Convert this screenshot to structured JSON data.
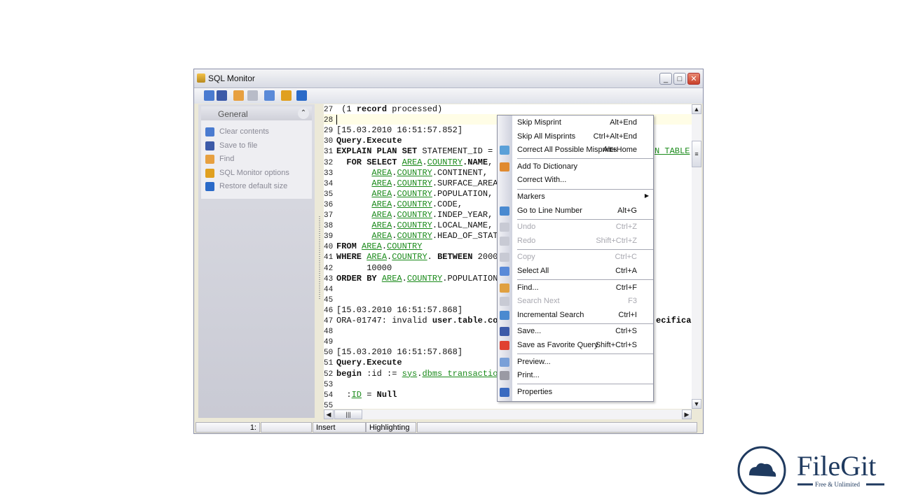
{
  "window": {
    "title": "SQL Monitor",
    "minimize": "_",
    "maximize": "□",
    "close": "✕"
  },
  "toolbar": [
    "clear-contents-icon",
    "save-icon",
    "find-icon",
    "search-next-icon",
    "print-icon",
    "options-icon",
    "restore-size-icon"
  ],
  "sidebar": {
    "group_title": "General",
    "collapse_glyph": "⌃",
    "items": [
      {
        "label": "Clear contents",
        "icon": "clear-contents-icon",
        "color": "#4a7bd0"
      },
      {
        "label": "Save to file",
        "icon": "save-icon",
        "color": "#3c5aa8"
      },
      {
        "label": "Find",
        "icon": "find-icon",
        "color": "#e7a040"
      },
      {
        "label": "SQL Monitor options",
        "icon": "options-icon",
        "color": "#e0a020"
      },
      {
        "label": "Restore default size",
        "icon": "restore-size-icon",
        "color": "#2a6ac8"
      }
    ]
  },
  "editor": {
    "lines": [
      {
        "n": "27",
        "s": [
          [
            "n",
            " (1 "
          ],
          [
            "k",
            "record"
          ],
          [
            "n",
            " processed)"
          ]
        ]
      },
      {
        "n": "28",
        "s": []
      },
      {
        "n": "29",
        "s": [
          [
            "n",
            "[15.03.2010 16:51:57.852]"
          ]
        ]
      },
      {
        "n": "30",
        "s": [
          [
            "k",
            "Query.Execute"
          ]
        ]
      },
      {
        "n": "31",
        "s": [
          [
            "k",
            "EXPLAIN PLAN SET"
          ],
          [
            "n",
            " STATEMENT_ID ="
          ]
        ]
      },
      {
        "n": "32",
        "s": [
          [
            "k",
            "  FOR SELECT "
          ],
          [
            "id",
            "AREA"
          ],
          [
            "n",
            "."
          ],
          [
            "id",
            "COUNTRY"
          ],
          [
            "k",
            ".NAME"
          ],
          [
            "n",
            ","
          ]
        ]
      },
      {
        "n": "33",
        "s": [
          [
            "n",
            "       "
          ],
          [
            "id",
            "AREA"
          ],
          [
            "n",
            "."
          ],
          [
            "id",
            "COUNTRY"
          ],
          [
            "n",
            ".CONTINENT,"
          ]
        ]
      },
      {
        "n": "34",
        "s": [
          [
            "n",
            "       "
          ],
          [
            "id",
            "AREA"
          ],
          [
            "n",
            "."
          ],
          [
            "id",
            "COUNTRY"
          ],
          [
            "n",
            ".SURFACE_AREA"
          ]
        ]
      },
      {
        "n": "35",
        "s": [
          [
            "n",
            "       "
          ],
          [
            "id",
            "AREA"
          ],
          [
            "n",
            "."
          ],
          [
            "id",
            "COUNTRY"
          ],
          [
            "n",
            ".POPULATION,"
          ]
        ]
      },
      {
        "n": "36",
        "s": [
          [
            "n",
            "       "
          ],
          [
            "id",
            "AREA"
          ],
          [
            "n",
            "."
          ],
          [
            "id",
            "COUNTRY"
          ],
          [
            "n",
            ".CODE,"
          ]
        ]
      },
      {
        "n": "37",
        "s": [
          [
            "n",
            "       "
          ],
          [
            "id",
            "AREA"
          ],
          [
            "n",
            "."
          ],
          [
            "id",
            "COUNTRY"
          ],
          [
            "n",
            ".INDEP_YEAR,"
          ]
        ]
      },
      {
        "n": "38",
        "s": [
          [
            "n",
            "       "
          ],
          [
            "id",
            "AREA"
          ],
          [
            "n",
            "."
          ],
          [
            "id",
            "COUNTRY"
          ],
          [
            "n",
            ".LOCAL_NAME,"
          ]
        ]
      },
      {
        "n": "39",
        "s": [
          [
            "n",
            "       "
          ],
          [
            "id",
            "AREA"
          ],
          [
            "n",
            "."
          ],
          [
            "id",
            "COUNTRY"
          ],
          [
            "n",
            ".HEAD_OF_STAT"
          ]
        ]
      },
      {
        "n": "40",
        "s": [
          [
            "k",
            "FROM "
          ],
          [
            "id",
            "AREA"
          ],
          [
            "n",
            "."
          ],
          [
            "id",
            "COUNTRY"
          ]
        ]
      },
      {
        "n": "41",
        "s": [
          [
            "k",
            "WHERE "
          ],
          [
            "id",
            "AREA"
          ],
          [
            "n",
            "."
          ],
          [
            "id",
            "COUNTRY"
          ],
          [
            "n",
            ". "
          ],
          [
            "k",
            "BETWEEN"
          ],
          [
            "n",
            " 2000"
          ]
        ]
      },
      {
        "n": "42",
        "s": [
          [
            "n",
            "      10000"
          ]
        ]
      },
      {
        "n": "43",
        "s": [
          [
            "k",
            "ORDER BY "
          ],
          [
            "id",
            "AREA"
          ],
          [
            "n",
            "."
          ],
          [
            "id",
            "COUNTRY"
          ],
          [
            "n",
            ".POPULATION"
          ]
        ]
      },
      {
        "n": "44",
        "s": []
      },
      {
        "n": "45",
        "s": []
      },
      {
        "n": "46",
        "s": [
          [
            "n",
            "[15.03.2010 16:51:57.868]"
          ]
        ]
      },
      {
        "n": "47",
        "s": [
          [
            "n",
            "ORA-01747: invalid "
          ],
          [
            "k",
            "user.table.co"
          ]
        ]
      },
      {
        "n": "48",
        "s": []
      },
      {
        "n": "49",
        "s": []
      },
      {
        "n": "50",
        "s": [
          [
            "n",
            "[15.03.2010 16:51:57.868]"
          ]
        ]
      },
      {
        "n": "51",
        "s": [
          [
            "k",
            "Query.Execute"
          ]
        ]
      },
      {
        "n": "52",
        "s": [
          [
            "k",
            "begin"
          ],
          [
            "n",
            " :id := "
          ],
          [
            "id",
            "sys"
          ],
          [
            "n",
            "."
          ],
          [
            "id",
            "dbms transactio"
          ]
        ]
      },
      {
        "n": "53",
        "s": []
      },
      {
        "n": "54",
        "s": [
          [
            "n",
            "  :"
          ],
          [
            "id",
            "ID"
          ],
          [
            "n",
            " = "
          ],
          [
            "k",
            "Null"
          ]
        ]
      },
      {
        "n": "55",
        "s": []
      }
    ],
    "tail_31": "N TABLE",
    "tail_47": "ecifica"
  },
  "status": {
    "position": "1:",
    "mode": "Insert",
    "highlighting": "Highlighting"
  },
  "context_menu": [
    {
      "label": "Skip Misprint",
      "shortcut": "Alt+End"
    },
    {
      "label": "Skip All Misprints",
      "shortcut": "Ctrl+Alt+End"
    },
    {
      "label": "Correct All Possible Misprints",
      "shortcut": "Alt+Home",
      "icon": "spellcheck-icon",
      "color": "#5aa0d8"
    },
    {
      "sep": true
    },
    {
      "label": "Add To Dictionary",
      "icon": "dictionary-icon",
      "color": "#e08a30"
    },
    {
      "label": "Correct With..."
    },
    {
      "sep": true
    },
    {
      "label": "Markers",
      "submenu": true
    },
    {
      "label": "Go to Line Number",
      "shortcut": "Alt+G",
      "icon": "goto-line-icon",
      "color": "#4a8ad0"
    },
    {
      "sep": true
    },
    {
      "label": "Undo",
      "shortcut": "Ctrl+Z",
      "disabled": true,
      "icon": "undo-icon",
      "color": "#c8cad4"
    },
    {
      "label": "Redo",
      "shortcut": "Shift+Ctrl+Z",
      "disabled": true,
      "icon": "redo-icon",
      "color": "#c8cad4"
    },
    {
      "sep": true
    },
    {
      "label": "Copy",
      "shortcut": "Ctrl+C",
      "disabled": true,
      "icon": "copy-icon",
      "color": "#c8cad4"
    },
    {
      "label": "Select All",
      "shortcut": "Ctrl+A",
      "icon": "select-all-icon",
      "color": "#5a8ad8"
    },
    {
      "sep": true
    },
    {
      "label": "Find...",
      "shortcut": "Ctrl+F",
      "icon": "find-icon",
      "color": "#e0a040"
    },
    {
      "label": "Search Next",
      "shortcut": "F3",
      "disabled": true,
      "icon": "search-next-icon",
      "color": "#c8cad4"
    },
    {
      "label": "Incremental Search",
      "shortcut": "Ctrl+I",
      "icon": "incremental-search-icon",
      "color": "#4a8ad0"
    },
    {
      "sep": true
    },
    {
      "label": "Save...",
      "shortcut": "Ctrl+S",
      "icon": "save-icon",
      "color": "#3c5aa8"
    },
    {
      "label": "Save as Favorite Query",
      "shortcut": "Shift+Ctrl+S",
      "icon": "favorite-icon",
      "color": "#e04030"
    },
    {
      "sep": true
    },
    {
      "label": "Preview...",
      "icon": "preview-icon",
      "color": "#7aa0d8"
    },
    {
      "label": "Print...",
      "icon": "print-icon",
      "color": "#9a9aa4"
    },
    {
      "sep": true
    },
    {
      "label": "Properties",
      "icon": "properties-icon",
      "color": "#3a6ac0"
    }
  ],
  "watermark": {
    "brand": "FileGit",
    "tagline": "Free & Unlimited"
  },
  "colors": {
    "identifier": "#1a8a1a",
    "current_line": "#fffde6",
    "brand": "#1f3a5f"
  }
}
